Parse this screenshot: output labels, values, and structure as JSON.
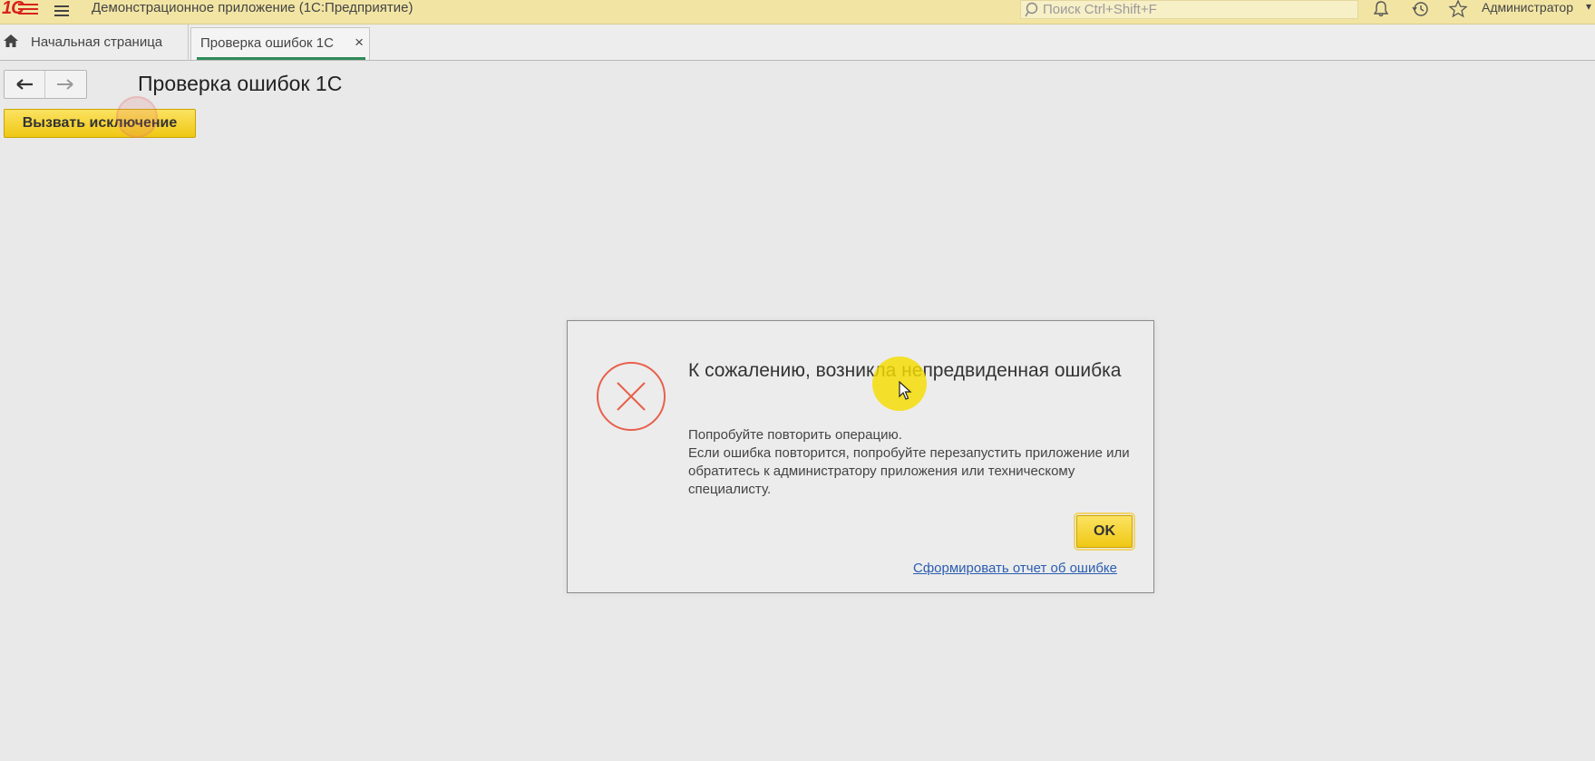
{
  "app": {
    "title": "Демонстрационное приложение  (1С:Предприятие)",
    "logo_text": "1С",
    "search_placeholder": "Поиск Ctrl+Shift+F",
    "user": "Администратор",
    "accent_color": "#f2e5a4"
  },
  "tabs": {
    "home_label": "Начальная страница",
    "active_label": "Проверка ошибок 1С",
    "close_glyph": "×"
  },
  "form": {
    "title": "Проверка ошибок 1С",
    "raise_button": "Вызвать исключение"
  },
  "dialog": {
    "title": "К сожалению, возникла непредвиденная ошибка",
    "line1": "Попробуйте повторить операцию.",
    "line2": "Если ошибка повторится, попробуйте перезапустить приложение или обратитесь к администратору приложения или техническому специалисту.",
    "ok_button": "OK",
    "report_link": "Сформировать отчет об ошибке",
    "error_color": "#e8604c"
  },
  "icons": [
    "menu-icon",
    "search-icon",
    "bell-icon",
    "history-icon",
    "star-icon",
    "home-icon",
    "arrow-left-icon",
    "arrow-right-icon",
    "error-cross-icon",
    "mouse-cursor-icon"
  ]
}
